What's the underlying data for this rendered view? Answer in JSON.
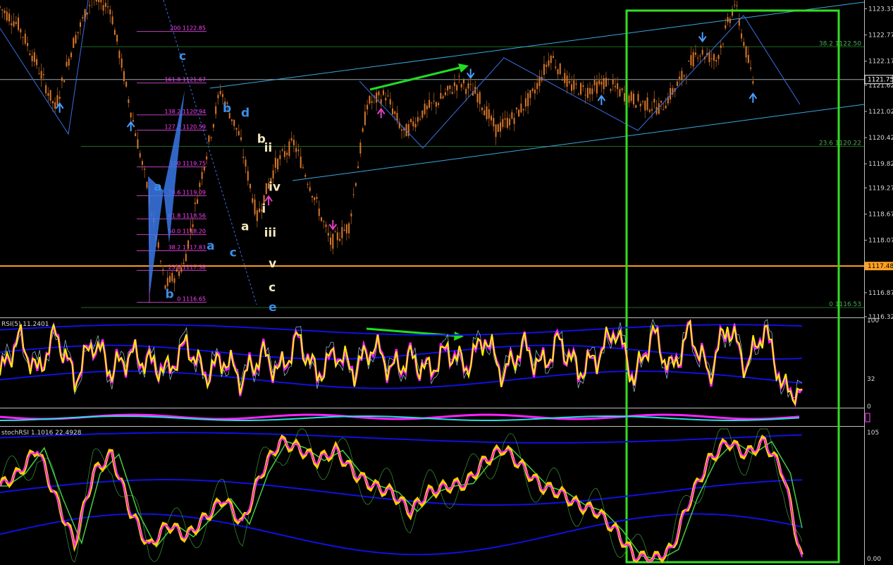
{
  "colors": {
    "background": "#000000",
    "candle": "#d9772a",
    "wick": "#8a4a16",
    "fib": "#c040c0",
    "fib_text": "#ff40ff",
    "channel": "#39a8e0",
    "wave_blue": "#3a8ee6",
    "wave_cream": "#f2e6bf",
    "arrow_green": "#22dd22",
    "box_green": "#33dd22",
    "horiz_orange": "#ffa020",
    "grid_green": "#1f6a1f",
    "rsi_yellow": "#ffee00",
    "rsi_magenta": "#ff22ff",
    "band_blue": "#1010e0",
    "axis_text": "#d8d8d8"
  },
  "chart_data": [
    {
      "type": "line",
      "panel": "price",
      "y_ticks": [
        "1123.37",
        "1122.77",
        "1122.17",
        "1121.62",
        "1121.02",
        "1120.42",
        "1119.82",
        "1119.27",
        "1118.67",
        "1118.07",
        "1117.48",
        "1116.87",
        "1116.32"
      ],
      "ylim": [
        1116.32,
        1123.57
      ],
      "price_marker": "1121.75",
      "level_marker": "1117.48",
      "x_index": [
        0,
        8,
        16,
        24,
        32,
        40,
        48,
        56,
        64,
        72,
        80,
        88,
        96,
        104,
        112,
        120,
        128,
        136,
        144,
        152,
        160,
        168,
        176,
        184,
        192,
        200,
        208,
        216,
        224,
        232,
        240,
        248,
        256,
        264,
        272,
        280,
        288,
        296,
        304,
        312,
        320,
        328
      ],
      "close": [
        1123.4,
        1123.0,
        1122.1,
        1121.1,
        1122.6,
        1123.6,
        1123.4,
        1121.3,
        1119.3,
        1117.0,
        1117.5,
        1119.6,
        1121.5,
        1120.5,
        1118.6,
        1119.8,
        1120.3,
        1119.2,
        1118.0,
        1118.4,
        1121.2,
        1121.4,
        1120.5,
        1121.0,
        1121.3,
        1121.7,
        1121.4,
        1120.6,
        1120.9,
        1121.4,
        1122.3,
        1121.6,
        1121.5,
        1121.7,
        1121.4,
        1121.2,
        1121.1,
        1121.7,
        1122.4,
        1122.2,
        1123.5,
        1121.7
      ],
      "fib_levels": [
        {
          "label": "200",
          "value": "1122.85"
        },
        {
          "label": "161.8",
          "value": "1121.67"
        },
        {
          "label": "138.2",
          "value": "1120.94"
        },
        {
          "label": "127.2",
          "value": "1120.59"
        },
        {
          "label": "100",
          "value": "1119.75"
        },
        {
          "label": "78.6",
          "value": "1119.09"
        },
        {
          "label": "61.8",
          "value": "1118.56"
        },
        {
          "label": "50.0",
          "value": "1118.20"
        },
        {
          "label": "38.2",
          "value": "1117.83"
        },
        {
          "label": "23.6",
          "value": "1117.38"
        },
        {
          "label": "0",
          "value": "1116.65"
        }
      ],
      "right_fib_levels": [
        {
          "label": "38.2",
          "value": "1122.50"
        },
        {
          "label": "23.6",
          "value": "1120.22"
        },
        {
          "label": "0",
          "value": "1116.53"
        }
      ],
      "wave_labels": [
        {
          "text": "c",
          "color": "blue",
          "x": 78,
          "y": 1122.2
        },
        {
          "text": "a",
          "color": "blue",
          "x": 67,
          "y": 1119.2
        },
        {
          "text": "b",
          "color": "blue",
          "x": 72,
          "y": 1116.75
        },
        {
          "text": "b",
          "color": "blue",
          "x": 97,
          "y": 1121.0
        },
        {
          "text": "d",
          "color": "blue",
          "x": 105,
          "y": 1120.9
        },
        {
          "text": "a",
          "color": "blue",
          "x": 90,
          "y": 1117.85
        },
        {
          "text": "c",
          "color": "blue",
          "x": 100,
          "y": 1117.7
        },
        {
          "text": "e",
          "color": "blue",
          "x": 117,
          "y": 1116.45
        },
        {
          "text": "b",
          "color": "cream",
          "x": 112,
          "y": 1120.3
        },
        {
          "text": "ii",
          "color": "cream",
          "x": 115,
          "y": 1120.1
        },
        {
          "text": "iv",
          "color": "cream",
          "x": 117,
          "y": 1119.2
        },
        {
          "text": "i",
          "color": "cream",
          "x": 114,
          "y": 1118.7
        },
        {
          "text": "a",
          "color": "cream",
          "x": 105,
          "y": 1118.3
        },
        {
          "text": "iii",
          "color": "cream",
          "x": 115,
          "y": 1118.15
        },
        {
          "text": "v",
          "color": "cream",
          "x": 117,
          "y": 1117.45
        },
        {
          "text": "c",
          "color": "cream",
          "x": 117,
          "y": 1116.9
        }
      ]
    },
    {
      "type": "line",
      "panel": "rsi",
      "title": "RSI(5) 11.2401",
      "ylim": [
        0,
        100
      ],
      "y_ticks": [
        "100",
        "32",
        "0"
      ],
      "x_index": [
        0,
        8,
        16,
        24,
        32,
        40,
        48,
        56,
        64,
        72,
        80,
        88,
        96,
        104,
        112,
        120,
        128,
        136,
        144,
        152,
        160,
        168,
        176,
        184,
        192,
        200,
        208,
        216,
        224,
        232,
        240,
        248,
        256,
        264,
        272,
        280,
        288,
        296,
        304,
        312,
        320,
        328,
        336,
        344
      ],
      "values": [
        35,
        80,
        38,
        85,
        30,
        75,
        40,
        60,
        50,
        40,
        72,
        35,
        55,
        30,
        60,
        40,
        78,
        35,
        62,
        40,
        70,
        42,
        55,
        40,
        65,
        45,
        80,
        35,
        70,
        45,
        75,
        40,
        55,
        90,
        30,
        85,
        40,
        88,
        35,
        95,
        45,
        90,
        20,
        11
      ]
    },
    {
      "type": "line",
      "panel": "stoch_rsi",
      "title": "stochRSI 1.1016 22.4928",
      "ylim": [
        0,
        105
      ],
      "y_ticks": [
        "105",
        "0.00"
      ],
      "x_index": [
        0,
        8,
        16,
        24,
        32,
        40,
        48,
        56,
        64,
        72,
        80,
        88,
        96,
        104,
        112,
        120,
        128,
        136,
        144,
        152,
        160,
        168,
        176,
        184,
        192,
        200,
        208,
        216,
        224,
        232,
        240,
        248,
        256,
        264,
        272,
        280,
        288,
        296,
        304,
        312,
        320,
        328,
        336,
        344
      ],
      "values": [
        60,
        70,
        90,
        50,
        15,
        70,
        85,
        40,
        12,
        30,
        20,
        35,
        50,
        30,
        70,
        95,
        90,
        80,
        88,
        70,
        60,
        55,
        40,
        55,
        60,
        62,
        80,
        90,
        75,
        60,
        55,
        45,
        40,
        25,
        5,
        2,
        10,
        50,
        80,
        95,
        85,
        95,
        70,
        1
      ]
    }
  ]
}
